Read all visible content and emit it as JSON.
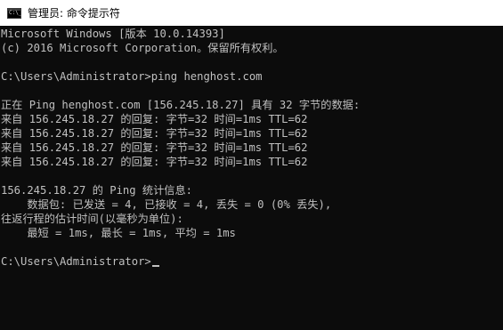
{
  "window": {
    "title": "管理员: 命令提示符",
    "icon": "console-app-icon",
    "icon_glyph": "C:\\_"
  },
  "console": {
    "lines": [
      "Microsoft Windows [版本 10.0.14393]",
      "(c) 2016 Microsoft Corporation。保留所有权利。",
      "",
      "C:\\Users\\Administrator>ping henghost.com",
      "",
      "正在 Ping henghost.com [156.245.18.27] 具有 32 字节的数据:",
      "来自 156.245.18.27 的回复: 字节=32 时间=1ms TTL=62",
      "来自 156.245.18.27 的回复: 字节=32 时间=1ms TTL=62",
      "来自 156.245.18.27 的回复: 字节=32 时间=1ms TTL=62",
      "来自 156.245.18.27 的回复: 字节=32 时间=1ms TTL=62",
      "",
      "156.245.18.27 的 Ping 统计信息:",
      "    数据包: 已发送 = 4, 已接收 = 4, 丢失 = 0 (0% 丢失),",
      "往返行程的估计时间(以毫秒为单位):",
      "    最短 = 1ms, 最长 = 1ms, 平均 = 1ms",
      ""
    ],
    "prompt": "C:\\Users\\Administrator>",
    "text_color": "#c0c0c0",
    "background_color": "#0c0c0c"
  }
}
